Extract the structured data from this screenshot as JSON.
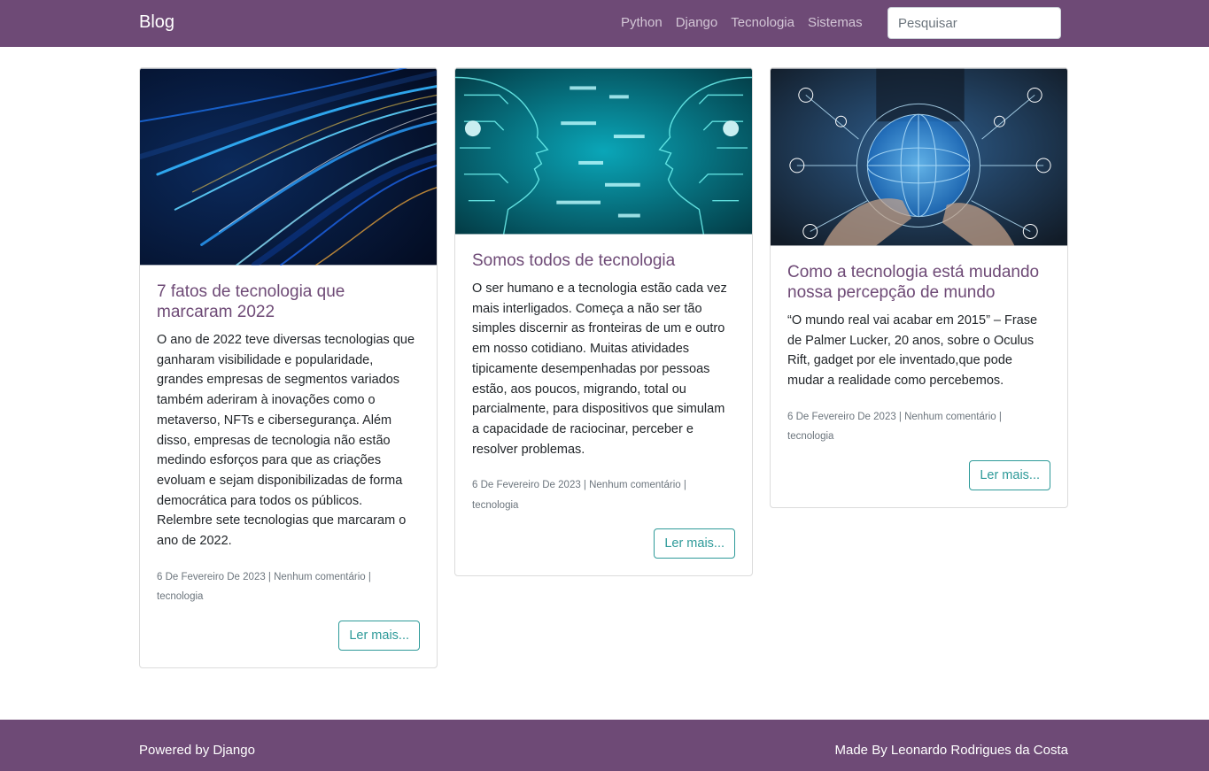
{
  "nav": {
    "brand": "Blog",
    "links": [
      "Python",
      "Django",
      "Tecnologia",
      "Sistemas"
    ],
    "search_placeholder": "Pesquisar"
  },
  "posts": [
    {
      "title": "7 fatos de tecnologia que marcaram 2022",
      "excerpt": "O ano de 2022 teve diversas tecnologias que ganharam visibilidade e popularidade, grandes empresas de segmentos variados também aderiram à inovações como o metaverso, NFTs e cibersegurança. Além disso, empresas de tecnologia não estão medindo esforços para que as criações evoluam e sejam disponibilizadas de forma democrática para todos os públicos. Relembre sete tecnologias que marcaram o ano de 2022.",
      "meta": "6 De Fevereiro De 2023 | Nenhum comentário | tecnologia",
      "button": "Ler mais...",
      "image": "fiber-optic-light-streaks"
    },
    {
      "title": "Somos todos de tecnologia",
      "excerpt": "O ser humano e a tecnologia estão cada vez mais interligados. Começa a não ser tão simples discernir as fronteiras de um e outro em nosso cotidiano. Muitas atividades tipicamente desempenhadas por pessoas estão, aos poucos, migrando, total ou parcialmente, para dispositivos que simulam a capacidade de raciocinar, perceber e resolver problemas.",
      "meta": "6 De Fevereiro De 2023 | Nenhum comentário | tecnologia",
      "button": "Ler mais...",
      "image": "circuit-faces"
    },
    {
      "title": "Como a tecnologia está mudando nossa percepção de mundo",
      "excerpt": "“O mundo real vai acabar em 2015” – Frase de Palmer Lucker, 20 anos, sobre o Oculus Rift, gadget por ele inventado,que pode mudar a realidade como percebemos.",
      "meta": "6 De Fevereiro De 2023 | Nenhum comentário | tecnologia",
      "button": "Ler mais...",
      "image": "digital-globe-network"
    }
  ],
  "footer": {
    "left": "Powered by Django",
    "right": "Made By Leonardo Rodrigues da Costa"
  }
}
